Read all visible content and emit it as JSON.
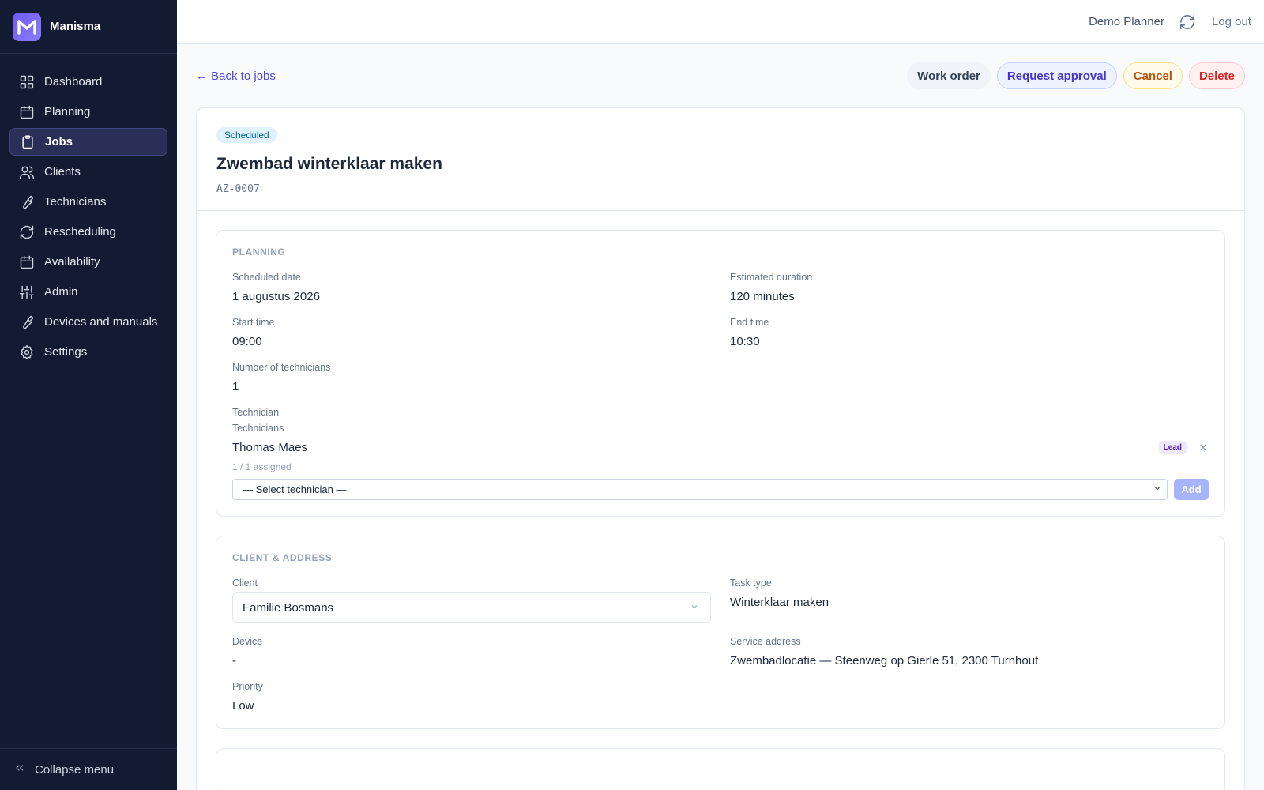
{
  "app": {
    "name": "Manisma"
  },
  "sidebar": {
    "items": [
      {
        "label": "Dashboard",
        "icon": "dashboard-icon"
      },
      {
        "label": "Planning",
        "icon": "calendar-icon"
      },
      {
        "label": "Jobs",
        "icon": "clipboard-icon",
        "active": true
      },
      {
        "label": "Clients",
        "icon": "users-icon"
      },
      {
        "label": "Technicians",
        "icon": "wrench-icon"
      },
      {
        "label": "Rescheduling",
        "icon": "refresh-icon"
      },
      {
        "label": "Availability",
        "icon": "calendar-icon"
      },
      {
        "label": "Admin",
        "icon": "sliders-icon"
      },
      {
        "label": "Devices and manuals",
        "icon": "wrench-icon"
      },
      {
        "label": "Settings",
        "icon": "gear-icon"
      }
    ],
    "collapse_label": "Collapse menu"
  },
  "topbar": {
    "user": "Demo Planner",
    "logout": "Log out"
  },
  "actions": {
    "back": "← Back to jobs",
    "work_order": "Work order",
    "request_approval": "Request approval",
    "cancel": "Cancel",
    "delete": "Delete"
  },
  "job": {
    "status": "Scheduled",
    "title": "Zwembad winterklaar maken",
    "code": "AZ-0007"
  },
  "planning": {
    "title": "PLANNING",
    "scheduled_date_label": "Scheduled date",
    "scheduled_date": "1 augustus 2026",
    "duration_label": "Estimated duration",
    "duration": "120 minutes",
    "start_label": "Start time",
    "start": "09:00",
    "end_label": "End time",
    "end": "10:30",
    "num_tech_label": "Number of technicians",
    "num_tech": "1",
    "technician_label": "Technician",
    "technicians_label": "Technicians",
    "technicians": [
      {
        "name": "Thomas Maes",
        "badge": "Lead"
      }
    ],
    "assigned": "1 / 1 assigned",
    "select_placeholder": "— Select technician —",
    "add": "Add"
  },
  "client_section": {
    "title": "CLIENT & ADDRESS",
    "client_label": "Client",
    "client": "Familie Bosmans",
    "task_type_label": "Task type",
    "task_type": "Winterklaar maken",
    "device_label": "Device",
    "device": "-",
    "address_label": "Service address",
    "address": "Zwembadlocatie — Steenweg op Gierle 51, 2300 Turnhout",
    "priority_label": "Priority",
    "priority": "Low"
  },
  "colors": {
    "sidebar_bg": "#131b33",
    "accent": "#4f46e5",
    "active_nav": "#2a2f58"
  }
}
